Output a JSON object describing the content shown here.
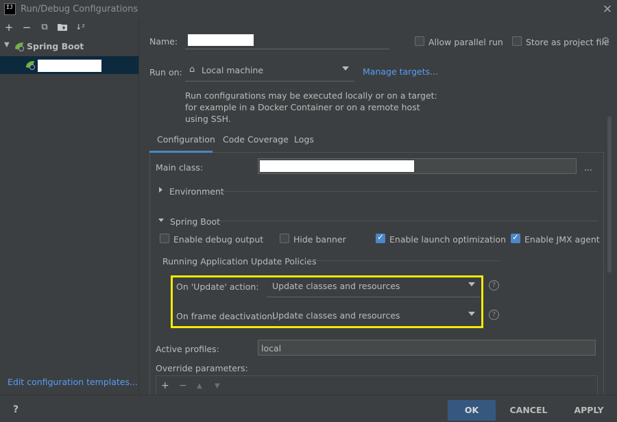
{
  "window": {
    "title": "Run/Debug Configurations",
    "app_icon_text": "IJ",
    "close_glyph": "✕"
  },
  "toolbar": {
    "add": "+",
    "remove": "−",
    "copy": "⧉",
    "folder": "📁",
    "sort": "↓²"
  },
  "tree": {
    "group_label": "Spring Boot",
    "expand_glyph": "▼"
  },
  "left_footer": {
    "edit_templates": "Edit configuration templates..."
  },
  "header": {
    "name_label": "Name:",
    "allow_parallel_label": "Allow parallel run",
    "allow_parallel_checked": false,
    "store_project_label": "Store as project file",
    "store_project_checked": false,
    "run_on_label": "Run on:",
    "run_on_value": "Local machine",
    "manage_targets": "Manage targets...",
    "hint": "Run configurations may be executed locally or on a target: for example in a Docker Container or on a remote host using SSH."
  },
  "tabs": [
    {
      "label": "Configuration",
      "active": true
    },
    {
      "label": "Code Coverage",
      "active": false
    },
    {
      "label": "Logs",
      "active": false
    }
  ],
  "config": {
    "main_class_label": "Main class:",
    "main_class_more": "...",
    "environment_label": "Environment",
    "spring_boot_label": "Spring Boot",
    "options": [
      {
        "label": "Enable debug output",
        "checked": false
      },
      {
        "label": "Hide banner",
        "checked": false
      },
      {
        "label": "Enable launch optimization",
        "checked": true
      },
      {
        "label": "Enable JMX agent",
        "checked": true
      }
    ],
    "policies_title": "Running Application Update Policies",
    "on_update_label": "On 'Update' action:",
    "on_update_value": "Update classes and resources",
    "on_frame_label": "On frame deactivation:",
    "on_frame_value": "Update classes and resources",
    "help_glyph": "?",
    "active_profiles_label": "Active profiles:",
    "active_profiles_value": "local",
    "override_label": "Override parameters:"
  },
  "override_tools": {
    "add": "+",
    "remove": "−",
    "up": "▲",
    "down": "▼"
  },
  "footer": {
    "help": "?",
    "ok": "OK",
    "cancel": "CANCEL",
    "apply": "APPLY"
  },
  "colors": {
    "background": "#3c3f41",
    "accent": "#4a88c7",
    "link": "#589df6",
    "highlight": "#f5ea0b",
    "selection": "#0d293e"
  }
}
